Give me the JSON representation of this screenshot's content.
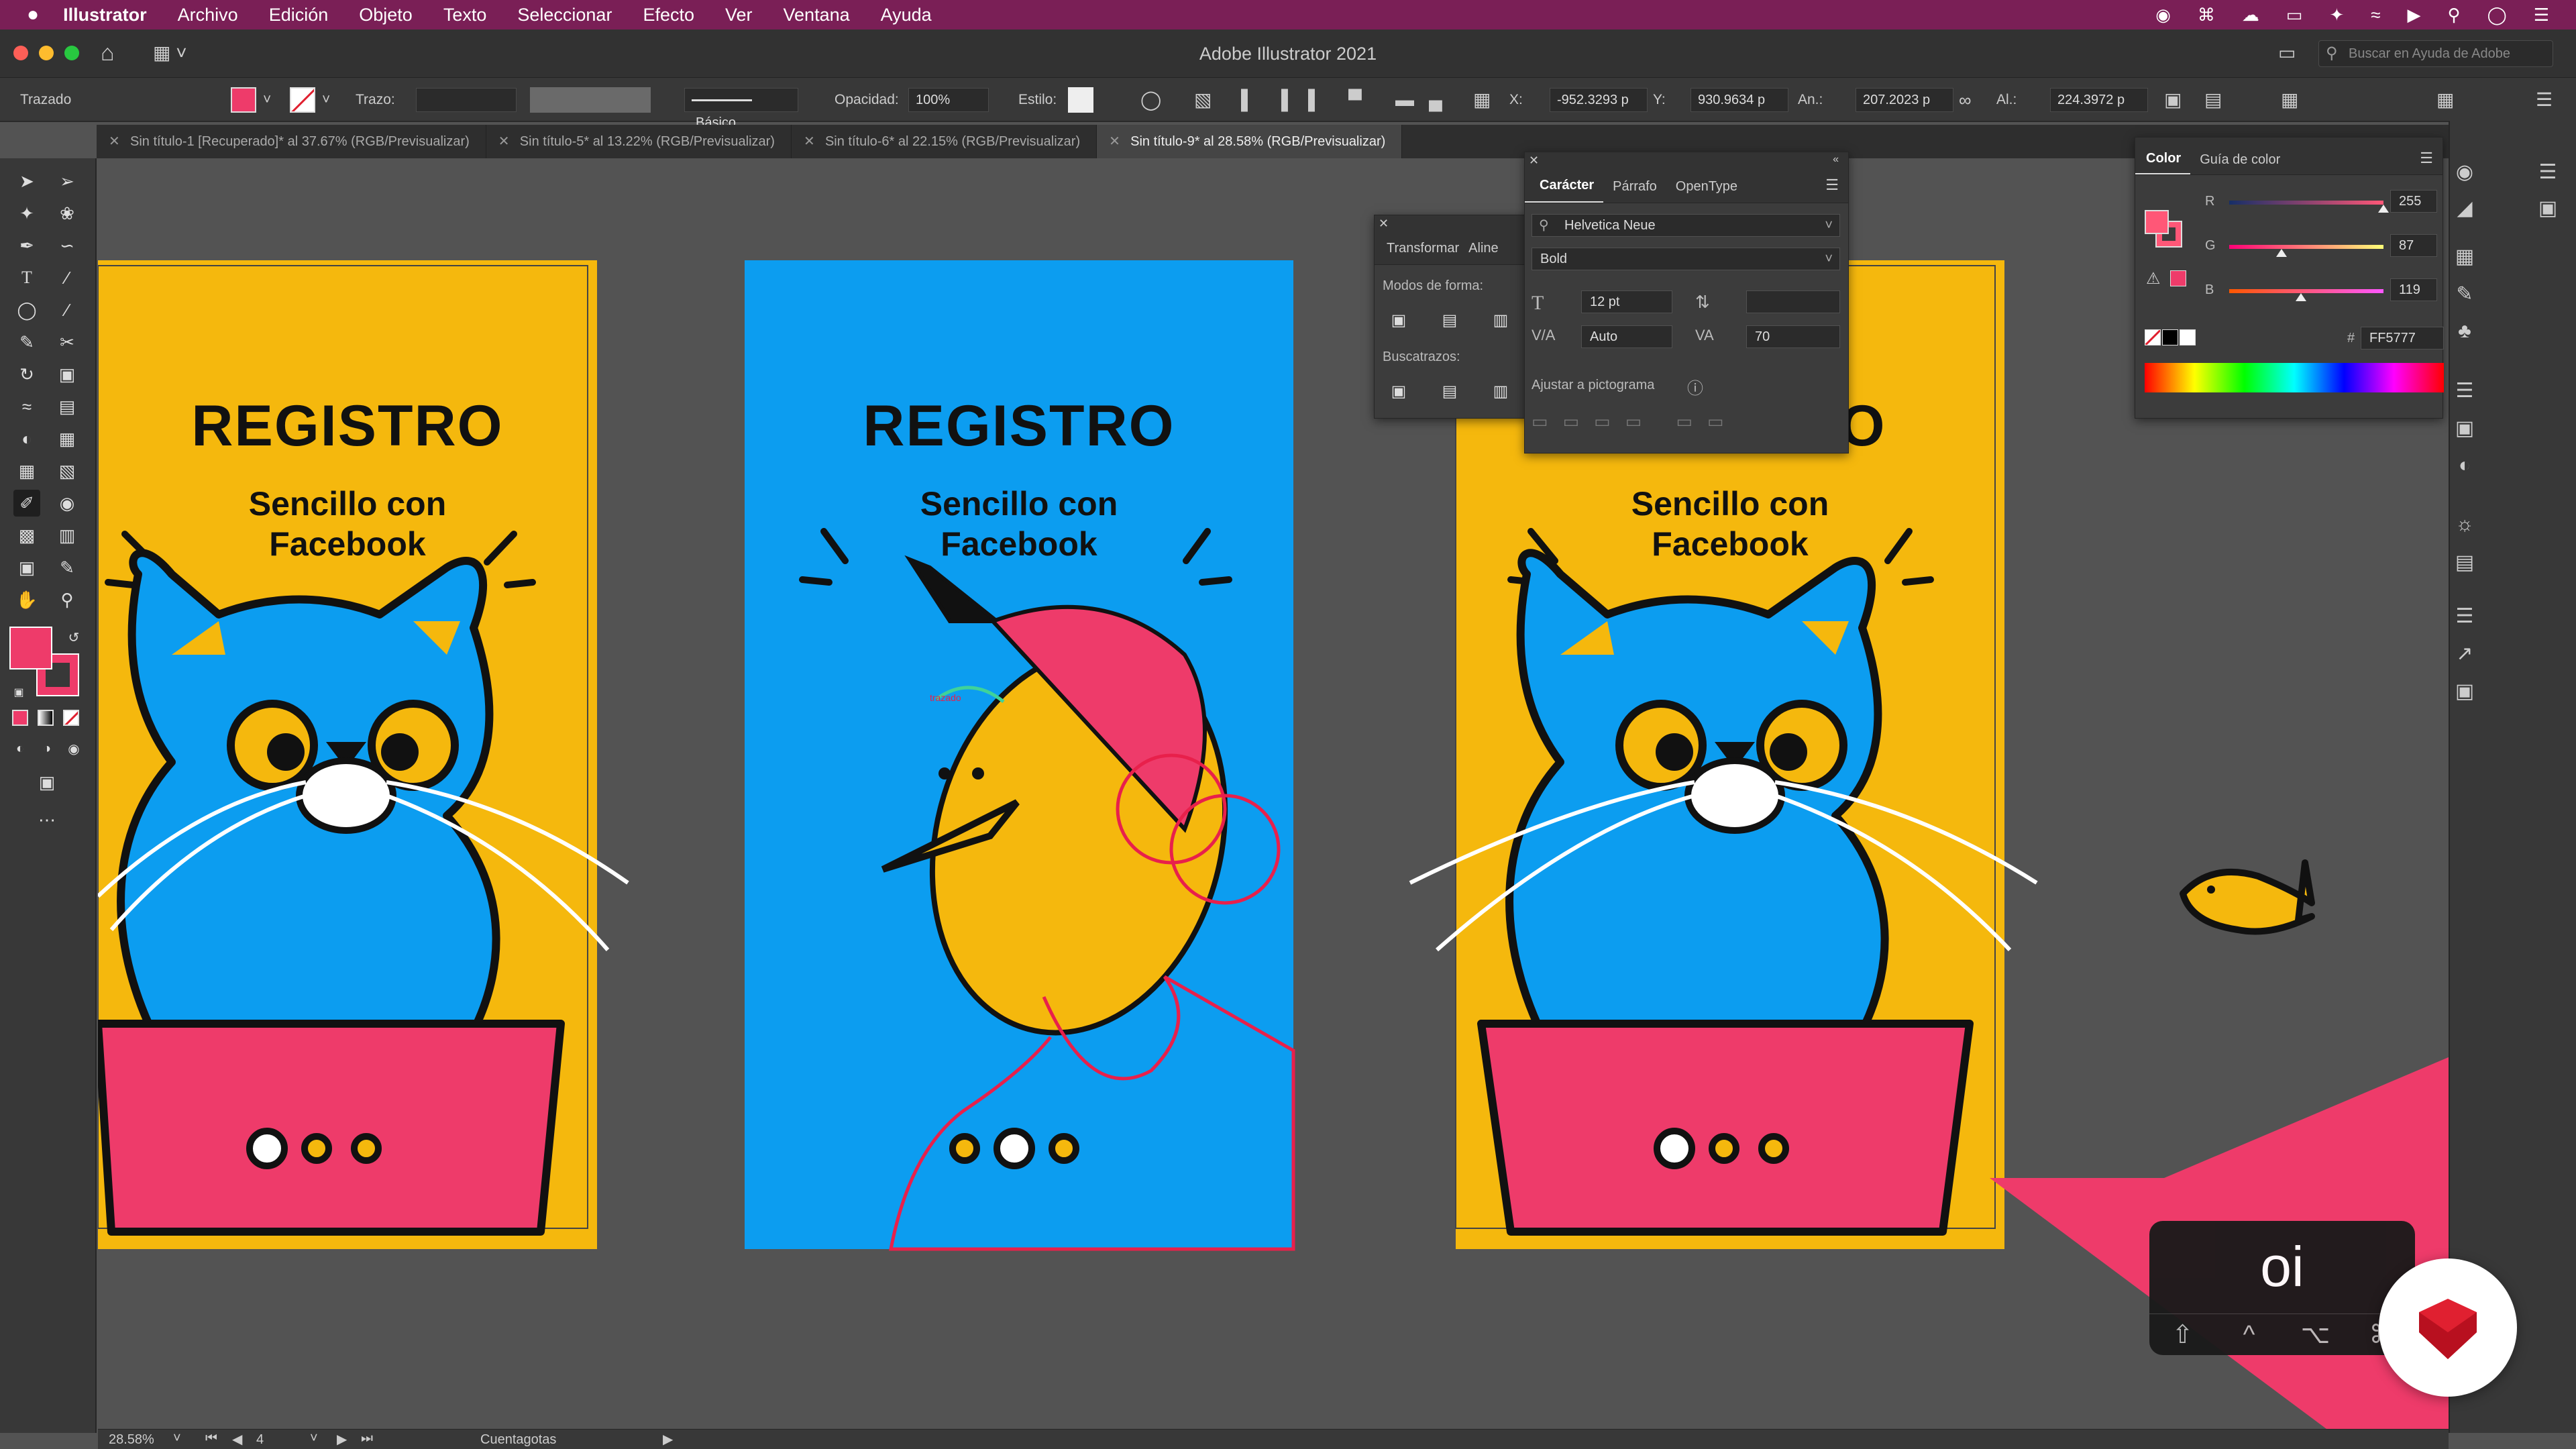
{
  "menubar": {
    "apple_icon": "apple-icon",
    "app_name": "Illustrator",
    "items": [
      "Archivo",
      "Edición",
      "Objeto",
      "Texto",
      "Seleccionar",
      "Efecto",
      "Ver",
      "Ventana",
      "Ayuda"
    ]
  },
  "window": {
    "title": "Adobe Illustrator 2021",
    "search_placeholder": "Buscar en Ayuda de Adobe"
  },
  "control_bar": {
    "selection_label": "Trazado",
    "stroke_label": "Trazo:",
    "brush_label": "Básico",
    "opacity_label": "Opacidad:",
    "opacity_value": "100%",
    "style_label": "Estilo:",
    "x_label": "X:",
    "x_value": "-952.3293 p",
    "y_label": "Y:",
    "y_value": "930.9634 p",
    "w_label": "An.:",
    "w_value": "207.2023 p",
    "h_label": "Al.:",
    "h_value": "224.3972 p",
    "fill_color": "#ee3b6a"
  },
  "tabs": [
    {
      "label": "Sin título-1 [Recuperado]* al 37.67% (RGB/Previsualizar)",
      "active": false
    },
    {
      "label": "Sin título-5* al 13.22% (RGB/Previsualizar)",
      "active": false
    },
    {
      "label": "Sin título-6* al 22.15% (RGB/Previsualizar)",
      "active": false
    },
    {
      "label": "Sin título-9* al 28.58% (RGB/Previsualizar)",
      "active": true
    }
  ],
  "artboards": {
    "title": "REGISTRO",
    "subtitle_line1": "Sencillo con",
    "subtitle_line2": "Facebook",
    "trazado_hint": "trazado",
    "colors": {
      "yellow": "#f5b80d",
      "blue": "#0c9df0",
      "pink": "#ee3b6a",
      "black": "#111111",
      "white": "#ffffff"
    }
  },
  "transform_panel": {
    "tabs": [
      "Transformar",
      "Aline"
    ],
    "shape_modes_label": "Modos de forma:",
    "pathfinders_label": "Buscatrazos:"
  },
  "character_panel": {
    "tabs": [
      "Carácter",
      "Párrafo",
      "OpenType"
    ],
    "font_family": "Helvetica Neue",
    "font_style": "Bold",
    "font_size": "12 pt",
    "leading": "",
    "kerning": "Auto",
    "tracking": "70",
    "snap_label": "Ajustar a pictograma"
  },
  "color_panel": {
    "tabs": [
      "Color",
      "Guía de color"
    ],
    "r_label": "R",
    "r_value": "255",
    "g_label": "G",
    "g_value": "87",
    "b_label": "B",
    "b_value": "119",
    "hex_label": "#",
    "hex_value": "FF5777",
    "current_color": "#ff5777",
    "r_fraction": 1.0,
    "g_fraction": 0.341,
    "b_fraction": 0.467
  },
  "status_bar": {
    "zoom": "28.58%",
    "artboard_number": "4",
    "tool_name": "Cuentagotas"
  },
  "keycast": {
    "key": "oi",
    "modifiers": [
      "⇧",
      "^",
      "⌥",
      "⌘"
    ]
  }
}
